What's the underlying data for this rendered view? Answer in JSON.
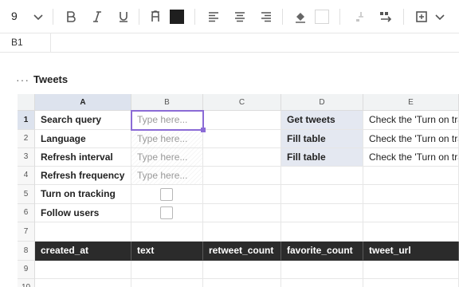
{
  "toolbar": {
    "font_size": "9",
    "icons": [
      "chevron-down-icon",
      "bold-icon",
      "italic-icon",
      "underline-icon",
      "text-color-icon",
      "fill-color-swatch",
      "align-left-icon",
      "align-center-icon",
      "align-right-icon",
      "paint-bucket-icon",
      "border-swatch",
      "freeze-icon",
      "wrap-icon",
      "merge-icon",
      "chevron-down-icon"
    ],
    "text_color": "#1f1f1f"
  },
  "namebar": {
    "cell_ref": "B1"
  },
  "sheet": {
    "menu": "···",
    "title": "Tweets"
  },
  "columns": [
    "A",
    "B",
    "C",
    "D",
    "E"
  ],
  "rows": [
    "1",
    "2",
    "3",
    "4",
    "5",
    "6",
    "7",
    "8",
    "9",
    "10"
  ],
  "labels": {
    "r1": "Search query",
    "r2": "Language",
    "r3": "Refresh interval",
    "r4": "Refresh frequency",
    "r5": "Turn on tracking",
    "r6": "Follow users"
  },
  "inputs": {
    "r1": "Type here...",
    "r2": "Type here...",
    "r3": "Type here...",
    "r4": "Type here..."
  },
  "actions": {
    "d1": "Get tweets",
    "d2": "Fill table",
    "d3": "Fill table"
  },
  "notes": {
    "e1": "Check the 'Turn on tracking' box to refresh",
    "e2": "Check the 'Turn on tracking' box to refresh",
    "e3": "Check the 'Turn on tracking' box to refresh"
  },
  "table_header": {
    "a": "created_at",
    "b": "text",
    "c": "retweet_count",
    "d": "favorite_count",
    "e": "tweet_url"
  },
  "colors": {
    "accent": "#8b6bd6",
    "header_dark": "#2b2b2b",
    "button_bg": "#e4e8f1"
  }
}
